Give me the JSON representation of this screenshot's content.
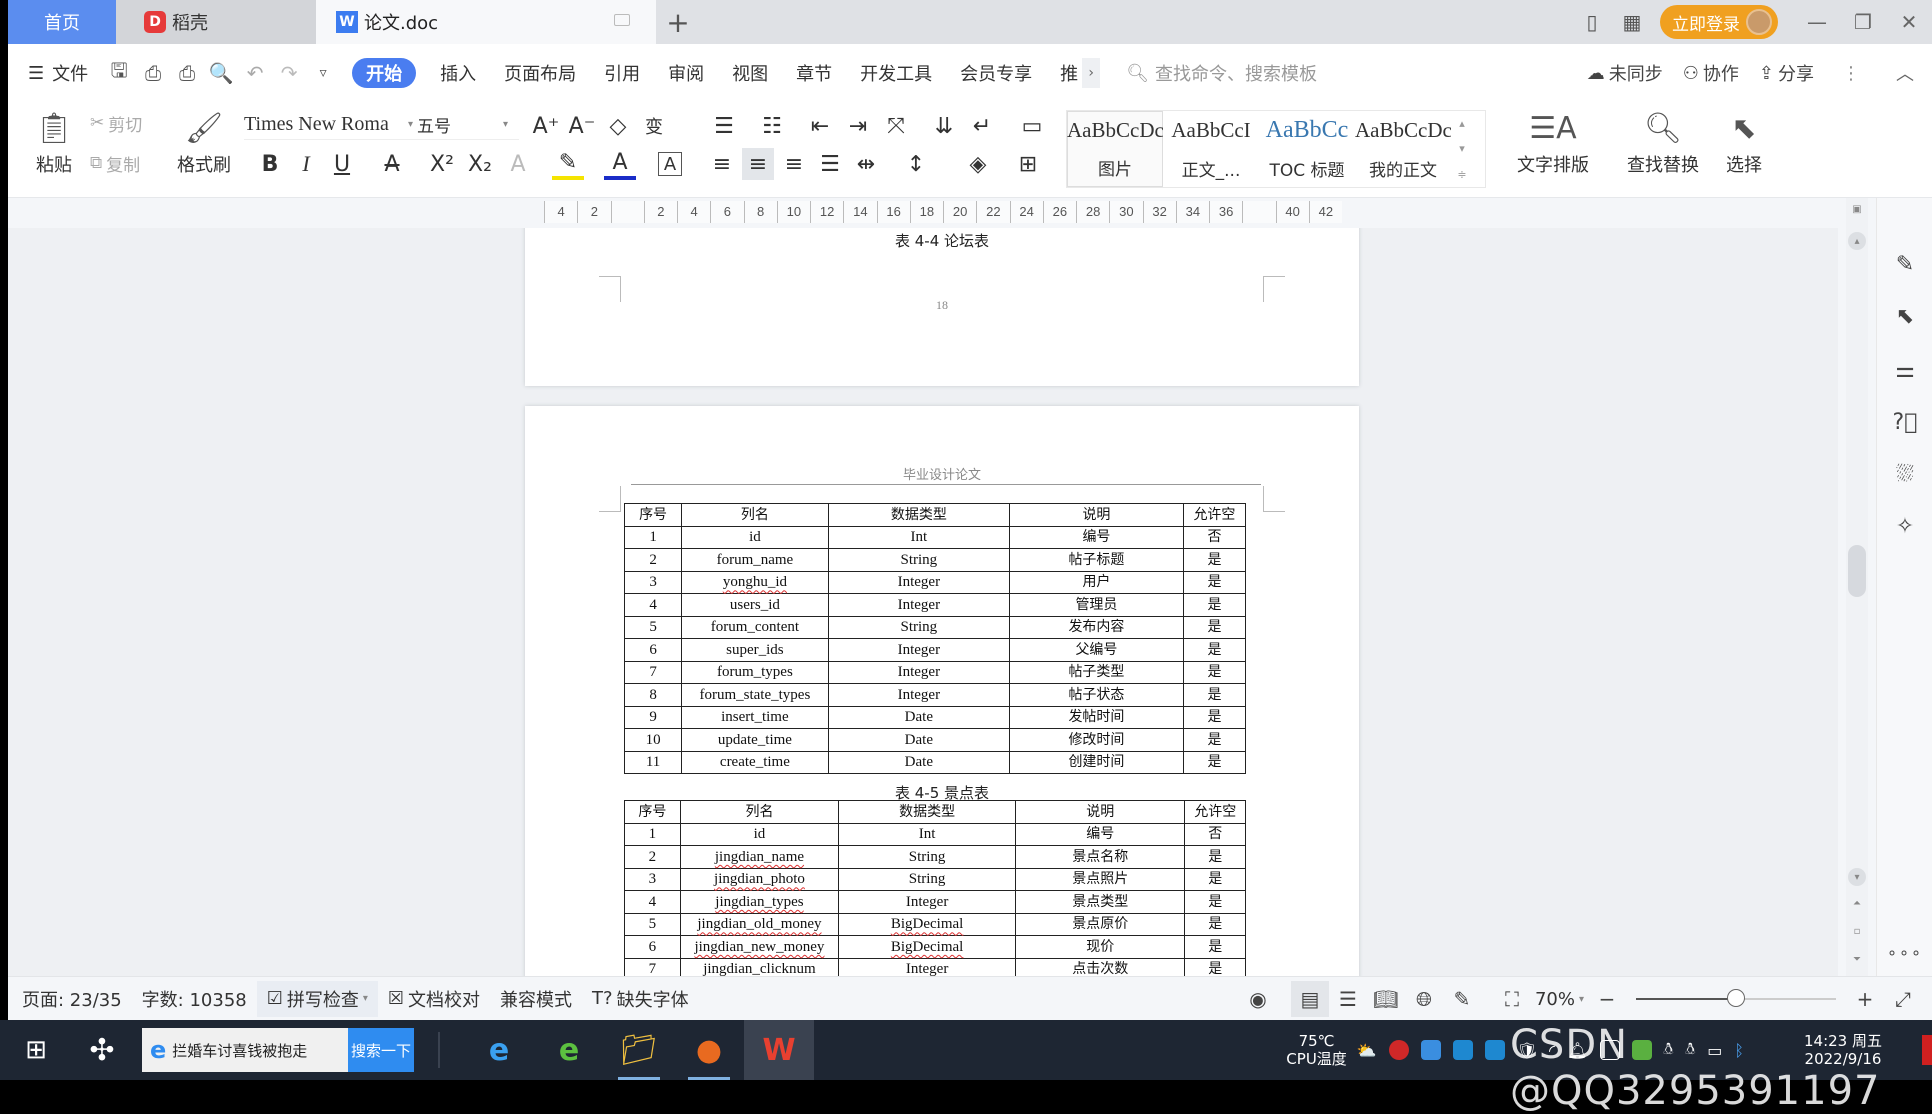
{
  "titlebar": {
    "tabs": [
      {
        "label": "首页",
        "active": false
      },
      {
        "label": "稻壳",
        "active": false
      },
      {
        "label": "论文.doc",
        "active": true
      }
    ],
    "new_tab": "+",
    "login_label": "立即登录",
    "window_controls": {
      "minimize": "—",
      "restore": "❐",
      "close": "✕"
    }
  },
  "menubar": {
    "file_label": "文件",
    "tabs": [
      "开始",
      "插入",
      "页面布局",
      "引用",
      "审阅",
      "视图",
      "章节",
      "开发工具",
      "会员专享",
      "推"
    ],
    "active_tab": "开始",
    "more": "›",
    "search_placeholder": "查找命令、搜索模板",
    "sync_label": "未同步",
    "collab_label": "协作",
    "share_label": "分享"
  },
  "ribbon": {
    "paste": "粘贴",
    "cut": "剪切",
    "copy": "复制",
    "format_painter": "格式刷",
    "font_name": "Times New Roma",
    "font_size": "五号",
    "styles": [
      {
        "preview": "AaBbCcDc",
        "label": "图片"
      },
      {
        "preview": "AaBbCcI",
        "label": "正文_..."
      },
      {
        "preview": "AaBbCc",
        "label": "TOC 标题"
      },
      {
        "preview": "AaBbCcDc",
        "label": "我的正文"
      }
    ],
    "text_layout": "文字排版",
    "find_replace": "查找替换",
    "select": "选择"
  },
  "ruler": {
    "ticks": [
      "4",
      "2",
      "",
      "2",
      "4",
      "6",
      "8",
      "10",
      "12",
      "14",
      "16",
      "18",
      "20",
      "22",
      "24",
      "26",
      "28",
      "30",
      "32",
      "34",
      "36",
      "",
      "40",
      "42"
    ]
  },
  "document": {
    "page18": {
      "caption": "表 4-4 论坛表",
      "page_number": "18"
    },
    "page19": {
      "header": "毕业设计论文",
      "table_headers": [
        "序号",
        "列名",
        "数据类型",
        "说明",
        "允许空"
      ],
      "table1": [
        [
          "1",
          "id",
          "Int",
          "编号",
          "否"
        ],
        [
          "2",
          "forum_name",
          "String",
          "帖子标题",
          "是"
        ],
        [
          "3",
          "yonghu_id",
          "Integer",
          "用户",
          "是"
        ],
        [
          "4",
          "users_id",
          "Integer",
          "管理员",
          "是"
        ],
        [
          "5",
          "forum_content",
          "String",
          "发布内容",
          "是"
        ],
        [
          "6",
          "super_ids",
          "Integer",
          "父编号",
          "是"
        ],
        [
          "7",
          "forum_types",
          "Integer",
          "帖子类型",
          "是"
        ],
        [
          "8",
          "forum_state_types",
          "Integer",
          "帖子状态",
          "是"
        ],
        [
          "9",
          "insert_time",
          "Date",
          "发帖时间",
          "是"
        ],
        [
          "10",
          "update_time",
          "Date",
          "修改时间",
          "是"
        ],
        [
          "11",
          "create_time",
          "Date",
          "创建时间",
          "是"
        ]
      ],
      "caption2": "表 4-5 景点表",
      "table2": [
        [
          "1",
          "id",
          "Int",
          "编号",
          "否"
        ],
        [
          "2",
          "jingdian_name",
          "String",
          "景点名称",
          "是"
        ],
        [
          "3",
          "jingdian_photo",
          "String",
          "景点照片",
          "是"
        ],
        [
          "4",
          "jingdian_types",
          "Integer",
          "景点类型",
          "是"
        ],
        [
          "5",
          "jingdian_old_money",
          "BigDecimal",
          "景点原价",
          "是"
        ],
        [
          "6",
          "jingdian_new_money",
          "BigDecimal",
          "现价",
          "是"
        ],
        [
          "7",
          "jingdian_clicknum",
          "Integer",
          "点击次数",
          "是"
        ]
      ]
    }
  },
  "scrollbar": {
    "position_fraction": 0.55
  },
  "statusbar": {
    "page": "页面: 23/35",
    "word_count": "字数: 10358",
    "spell_check": "拼写检查",
    "doc_proof": "文档校对",
    "compat_mode": "兼容模式",
    "missing_font": "缺失字体",
    "zoom_level": "70%",
    "zoom_fraction": 0.5
  },
  "taskbar": {
    "search_text": "拦婚车讨喜钱被抱走",
    "search_button": "搜索一下",
    "cpu_temp": "75℃",
    "cpu_label": "CPU温度",
    "time": "14:23 周五",
    "date": "2022/9/16"
  },
  "watermark": "CSDN @QQ3295391197"
}
